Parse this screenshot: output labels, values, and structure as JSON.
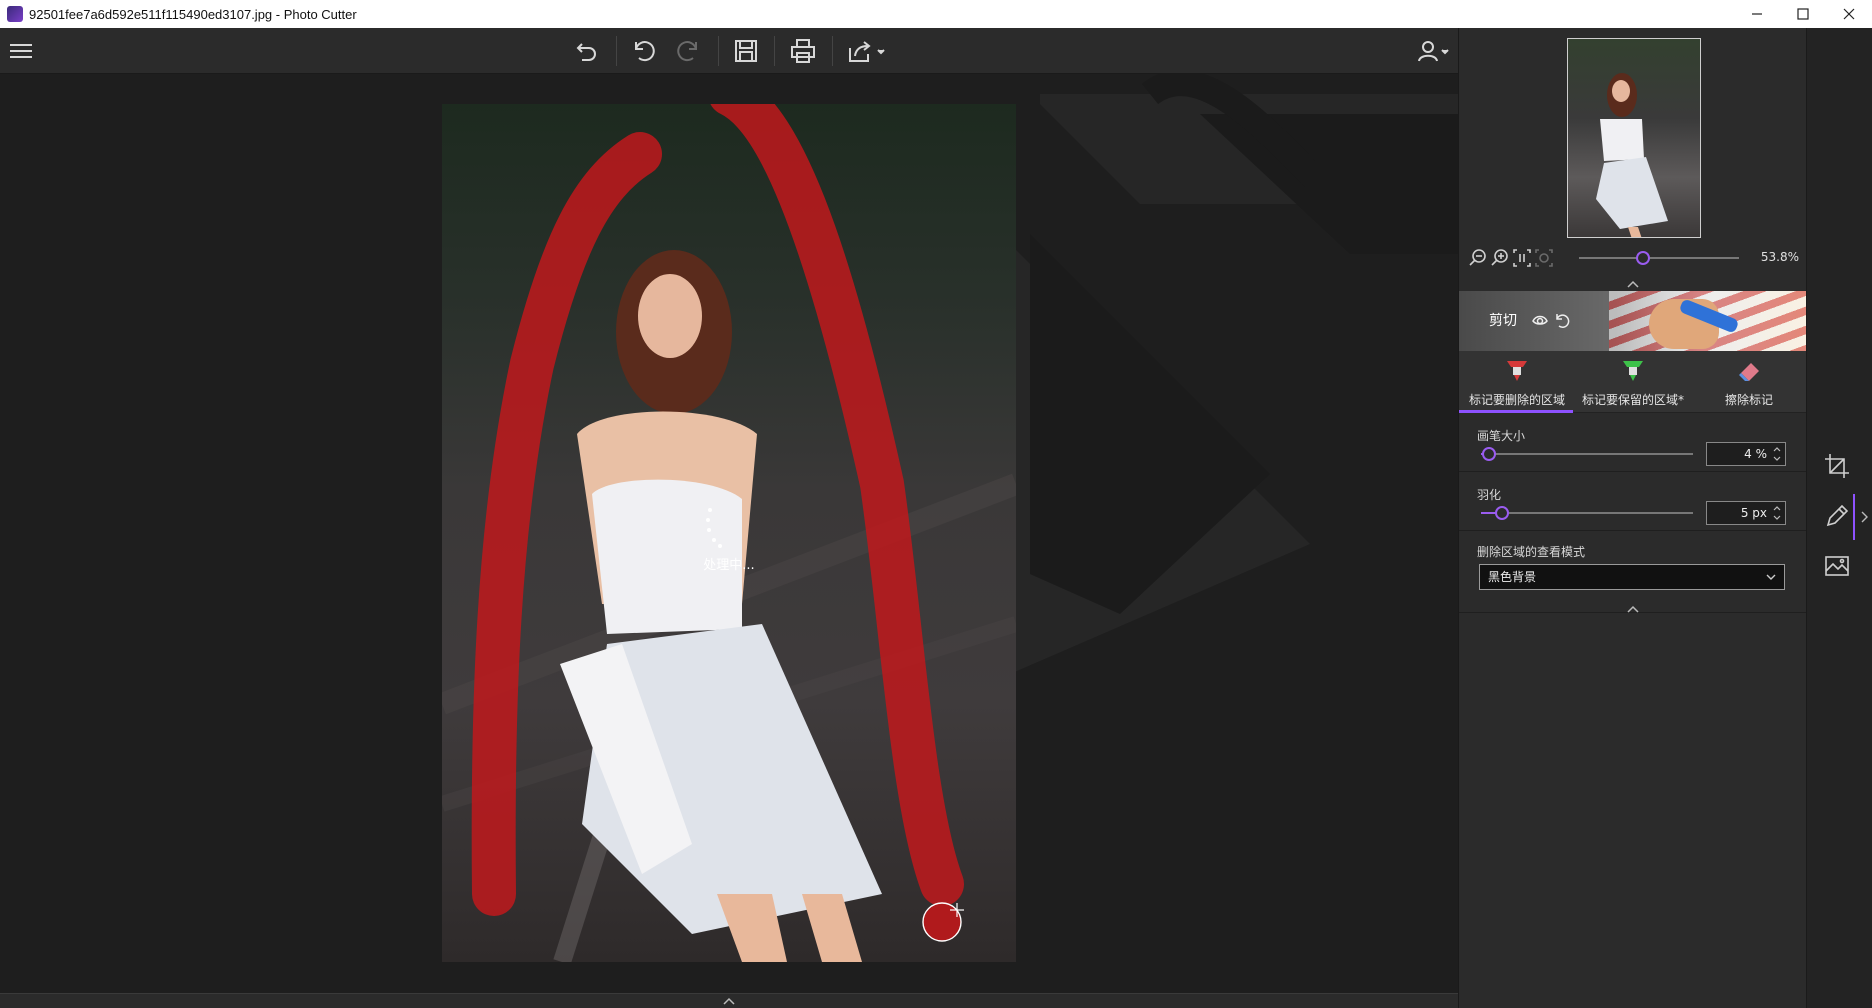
{
  "window": {
    "title": "92501fee7a6d592e511f115490ed3107.jpg - Photo Cutter"
  },
  "toolbar": {
    "icons": [
      "menu-icon",
      "undo-history-icon",
      "undo-icon",
      "redo-icon",
      "save-icon",
      "print-icon",
      "share-icon",
      "user-icon"
    ]
  },
  "canvas": {
    "processing_text": "处理中..."
  },
  "panel": {
    "zoom_value": "53.8%",
    "zoom_level": 0.4,
    "cut_label": "剪切",
    "modes": [
      {
        "label": "标记要删除的区域",
        "color": "#d63a3a"
      },
      {
        "label": "标记要保留的区域*",
        "color": "#3ec24a"
      },
      {
        "label": "擦除标记",
        "color": "#e07a8a"
      }
    ],
    "brush_size": {
      "label": "画笔大小",
      "value": "4 %",
      "level": 0.04
    },
    "feather": {
      "label": "羽化",
      "value": "5 px",
      "level": 0.1
    },
    "view_mode": {
      "label": "删除区域的查看模式",
      "selected": "黑色背景"
    }
  },
  "colors": {
    "accent": "#8e52ff",
    "mark_remove": "#c0191c"
  }
}
